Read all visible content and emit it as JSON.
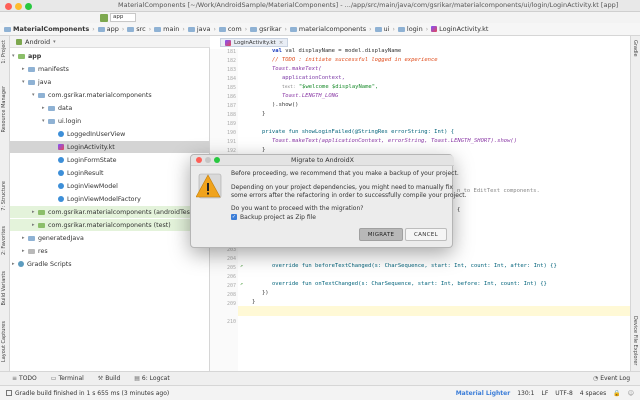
{
  "window": {
    "title": "MaterialComponents [~/Work/AndroidSample/MaterialComponents] - .../app/src/main/java/com/gsrikar/materialcomponents/ui/login/LoginActivity.kt [app]",
    "run_config": "app"
  },
  "breadcrumbs": [
    "MaterialComponents",
    "app",
    "src",
    "main",
    "java",
    "com",
    "gsrikar",
    "materialcomponents",
    "ui",
    "login",
    "LoginActivity.kt"
  ],
  "left_tool_tabs": [
    "1: Project",
    "Resource Manager",
    "7: Structure",
    "2: Favorites",
    "Build Variants",
    "Layout Captures"
  ],
  "right_tool_tabs": [
    "Gradle",
    "Device File Explorer"
  ],
  "project_panel": {
    "view_mode": "Android",
    "tree": [
      {
        "label": "app",
        "depth": 0,
        "icon": "folder"
      },
      {
        "label": "manifests",
        "depth": 1,
        "icon": "folder"
      },
      {
        "label": "java",
        "depth": 1,
        "icon": "folder"
      },
      {
        "label": "com.gsrikar.materialcomponents",
        "depth": 2,
        "icon": "package"
      },
      {
        "label": "data",
        "depth": 3,
        "icon": "package"
      },
      {
        "label": "ui.login",
        "depth": 3,
        "icon": "package"
      },
      {
        "label": "LoggedInUserView",
        "depth": 4,
        "icon": "kotlin-class"
      },
      {
        "label": "LoginActivity.kt",
        "depth": 4,
        "icon": "kotlin-file",
        "selected": true
      },
      {
        "label": "LoginFormState",
        "depth": 4,
        "icon": "kotlin-class"
      },
      {
        "label": "LoginResult",
        "depth": 4,
        "icon": "kotlin-class"
      },
      {
        "label": "LoginViewModel",
        "depth": 4,
        "icon": "kotlin-class"
      },
      {
        "label": "LoginViewModelFactory",
        "depth": 4,
        "icon": "kotlin-class"
      },
      {
        "label": "com.gsrikar.materialcomponents (androidTest)",
        "depth": 2,
        "icon": "package-test"
      },
      {
        "label": "com.gsrikar.materialcomponents (test)",
        "depth": 2,
        "icon": "package-test"
      },
      {
        "label": "generatedJava",
        "depth": 1,
        "icon": "folder"
      },
      {
        "label": "res",
        "depth": 1,
        "icon": "folder"
      },
      {
        "label": "Gradle Scripts",
        "depth": 0,
        "icon": "gradle"
      }
    ]
  },
  "editor": {
    "tab_label": "LoginActivity.kt",
    "line_numbers": [
      "181",
      "182",
      "183",
      "184",
      "185",
      "186",
      "187",
      "188",
      "189",
      "190",
      "191",
      "192",
      "193",
      "194",
      "195",
      "196",
      "197",
      "198",
      "199",
      "200",
      "201",
      "202",
      "203",
      "204",
      "205",
      "206",
      "207",
      "208",
      "209",
      "210"
    ],
    "code": {
      "l1": "val displayName = model.displayName",
      "l2": "// TODO : initiate successful logged in experience",
      "l3": "Toast.makeText(",
      "l4": "applicationContext,",
      "l5_hint": "text:",
      "l5": "\"$welcome $displayName\",",
      "l6": "Toast.LENGTH_LONG",
      "l7": ").show()",
      "l8": "}",
      "l9": "private fun showLoginFailed(@StringRes errorString: Int) {",
      "l10": "Toast.makeText(applicationContext, errorString, Toast.LENGTH_SHORT).show()",
      "l11": "}",
      "l12": "n to EditText components.",
      "l13": "{",
      "l14": "}",
      "l15": "override fun beforeTextChanged(s: CharSequence, start: Int, count: Int, after: Int) {}",
      "l16": "override fun onTextChanged(s: CharSequence, start: Int, before: Int, count: Int) {}",
      "l17": "})",
      "l18": "}"
    }
  },
  "dialog": {
    "title": "Migrate to AndroidX",
    "message1": "Before proceeding, we recommend that you make a backup of your project.",
    "message2a": "Depending on your project dependencies, you might need to manually fix",
    "message2b": "some errors after the refactoring in order to successfully compile your project.",
    "question": "Do you want to proceed with the migration?",
    "checkbox_label": "Backup project as Zip file",
    "checkbox_checked": true,
    "migrate_label": "MIGRATE",
    "cancel_label": "CANCEL"
  },
  "bottom_tools": [
    "TODO",
    "Terminal",
    "Build",
    "6: Logcat"
  ],
  "event_log": "Event Log",
  "status": {
    "message": "Gradle build finished in 1 s 655 ms (3 minutes ago)",
    "theme": "Material Lighter",
    "position": "130:1",
    "line_sep": "LF",
    "encoding": "UTF-8",
    "indent": "4 spaces"
  },
  "colors": {
    "accent": "#3b7dd8",
    "selection": "#d4d4d4",
    "test_highlight": "#e4f3db",
    "warning_icon": "#f0a31c"
  }
}
